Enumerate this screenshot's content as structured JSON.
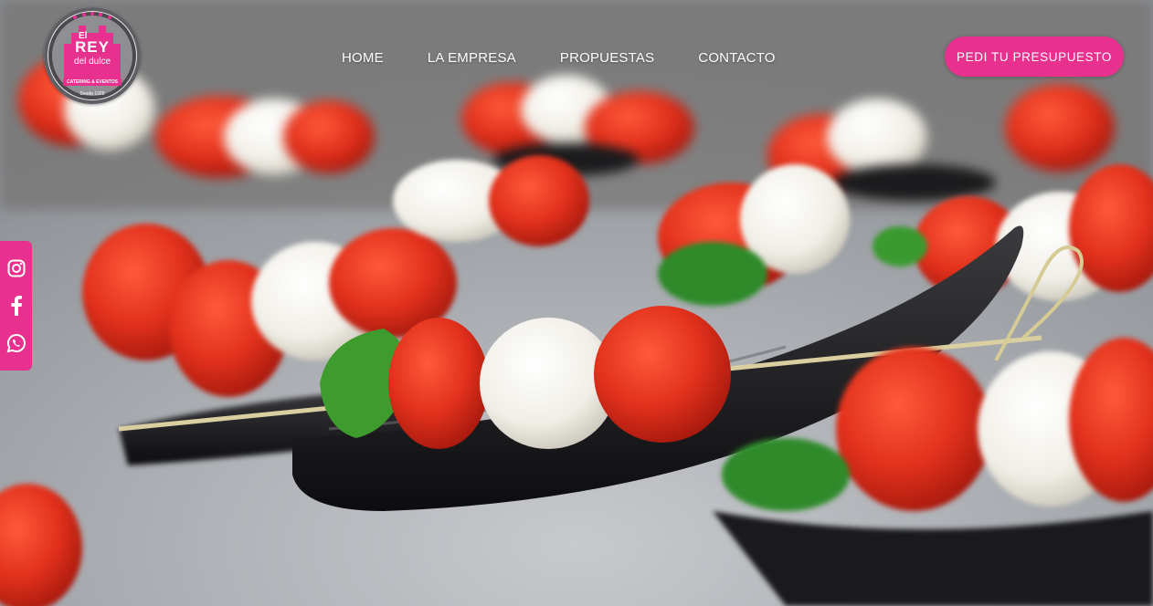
{
  "logo": {
    "line1": "El",
    "line2": "REY",
    "line3": "del dulce",
    "tagline": "CATERING & EVENTOS",
    "since": "Desde 1928",
    "color": "#e8308e"
  },
  "nav": {
    "items": [
      {
        "label": "HOME"
      },
      {
        "label": "LA EMPRESA"
      },
      {
        "label": "PROPUESTAS"
      },
      {
        "label": "CONTACTO"
      }
    ]
  },
  "cta": {
    "label": "PEDI TU  PRESUPUESTO"
  },
  "social": {
    "icons": [
      "instagram-icon",
      "facebook-icon",
      "whatsapp-icon"
    ],
    "color": "#e8308e"
  },
  "hero": {
    "image": "caprese skewers on black spoons"
  }
}
